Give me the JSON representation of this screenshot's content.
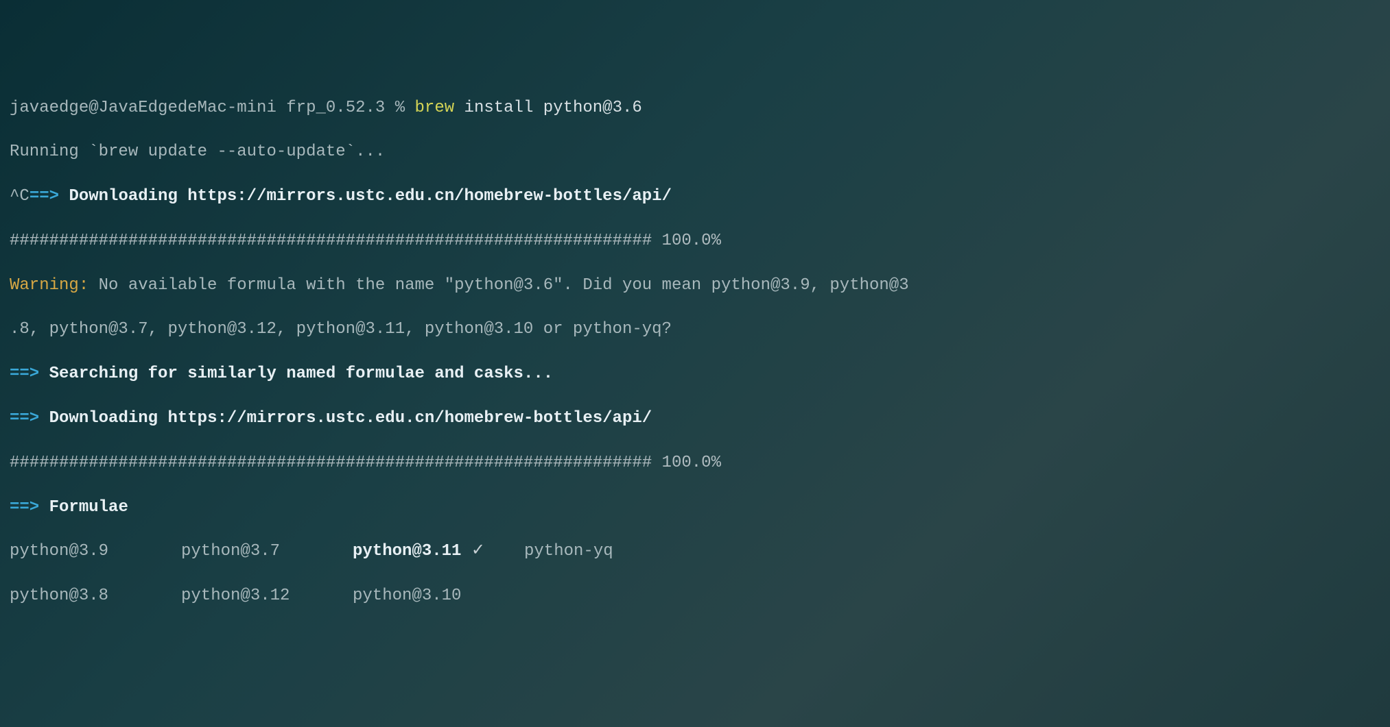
{
  "prompt": {
    "user_host": "javaedge@JavaEdgedeMac-mini",
    "cwd": "frp_0.52.3",
    "separator": "%",
    "command_brew": "brew",
    "command_rest": " install python@3.6"
  },
  "lines": {
    "running": "Running `brew update --auto-update`...",
    "ctrl_c": "^C",
    "arrow": "==>",
    "downloading": "Downloading https://mirrors.ustc.edu.cn/homebrew-bottles/api/",
    "progress_bar": "################################################################# 100.0%",
    "warning_label": "Warning:",
    "warning_text": " No available formula with the name \"python@3.6\". Did you mean python@3.9, python@3",
    "warning_text2": ".8, python@3.7, python@3.12, python@3.11, python@3.10 or python-yq?",
    "searching": "Searching for similarly named formulae and casks...",
    "formulae_header": "Formulae"
  },
  "formulae": {
    "row1": {
      "c1": "python@3.9",
      "c2": "python@3.7",
      "c3": "python@3.11",
      "check": " ✓",
      "c4": "python-yq"
    },
    "row2": {
      "c1": "python@3.8",
      "c2": "python@3.12",
      "c3": "python@3.10"
    }
  }
}
